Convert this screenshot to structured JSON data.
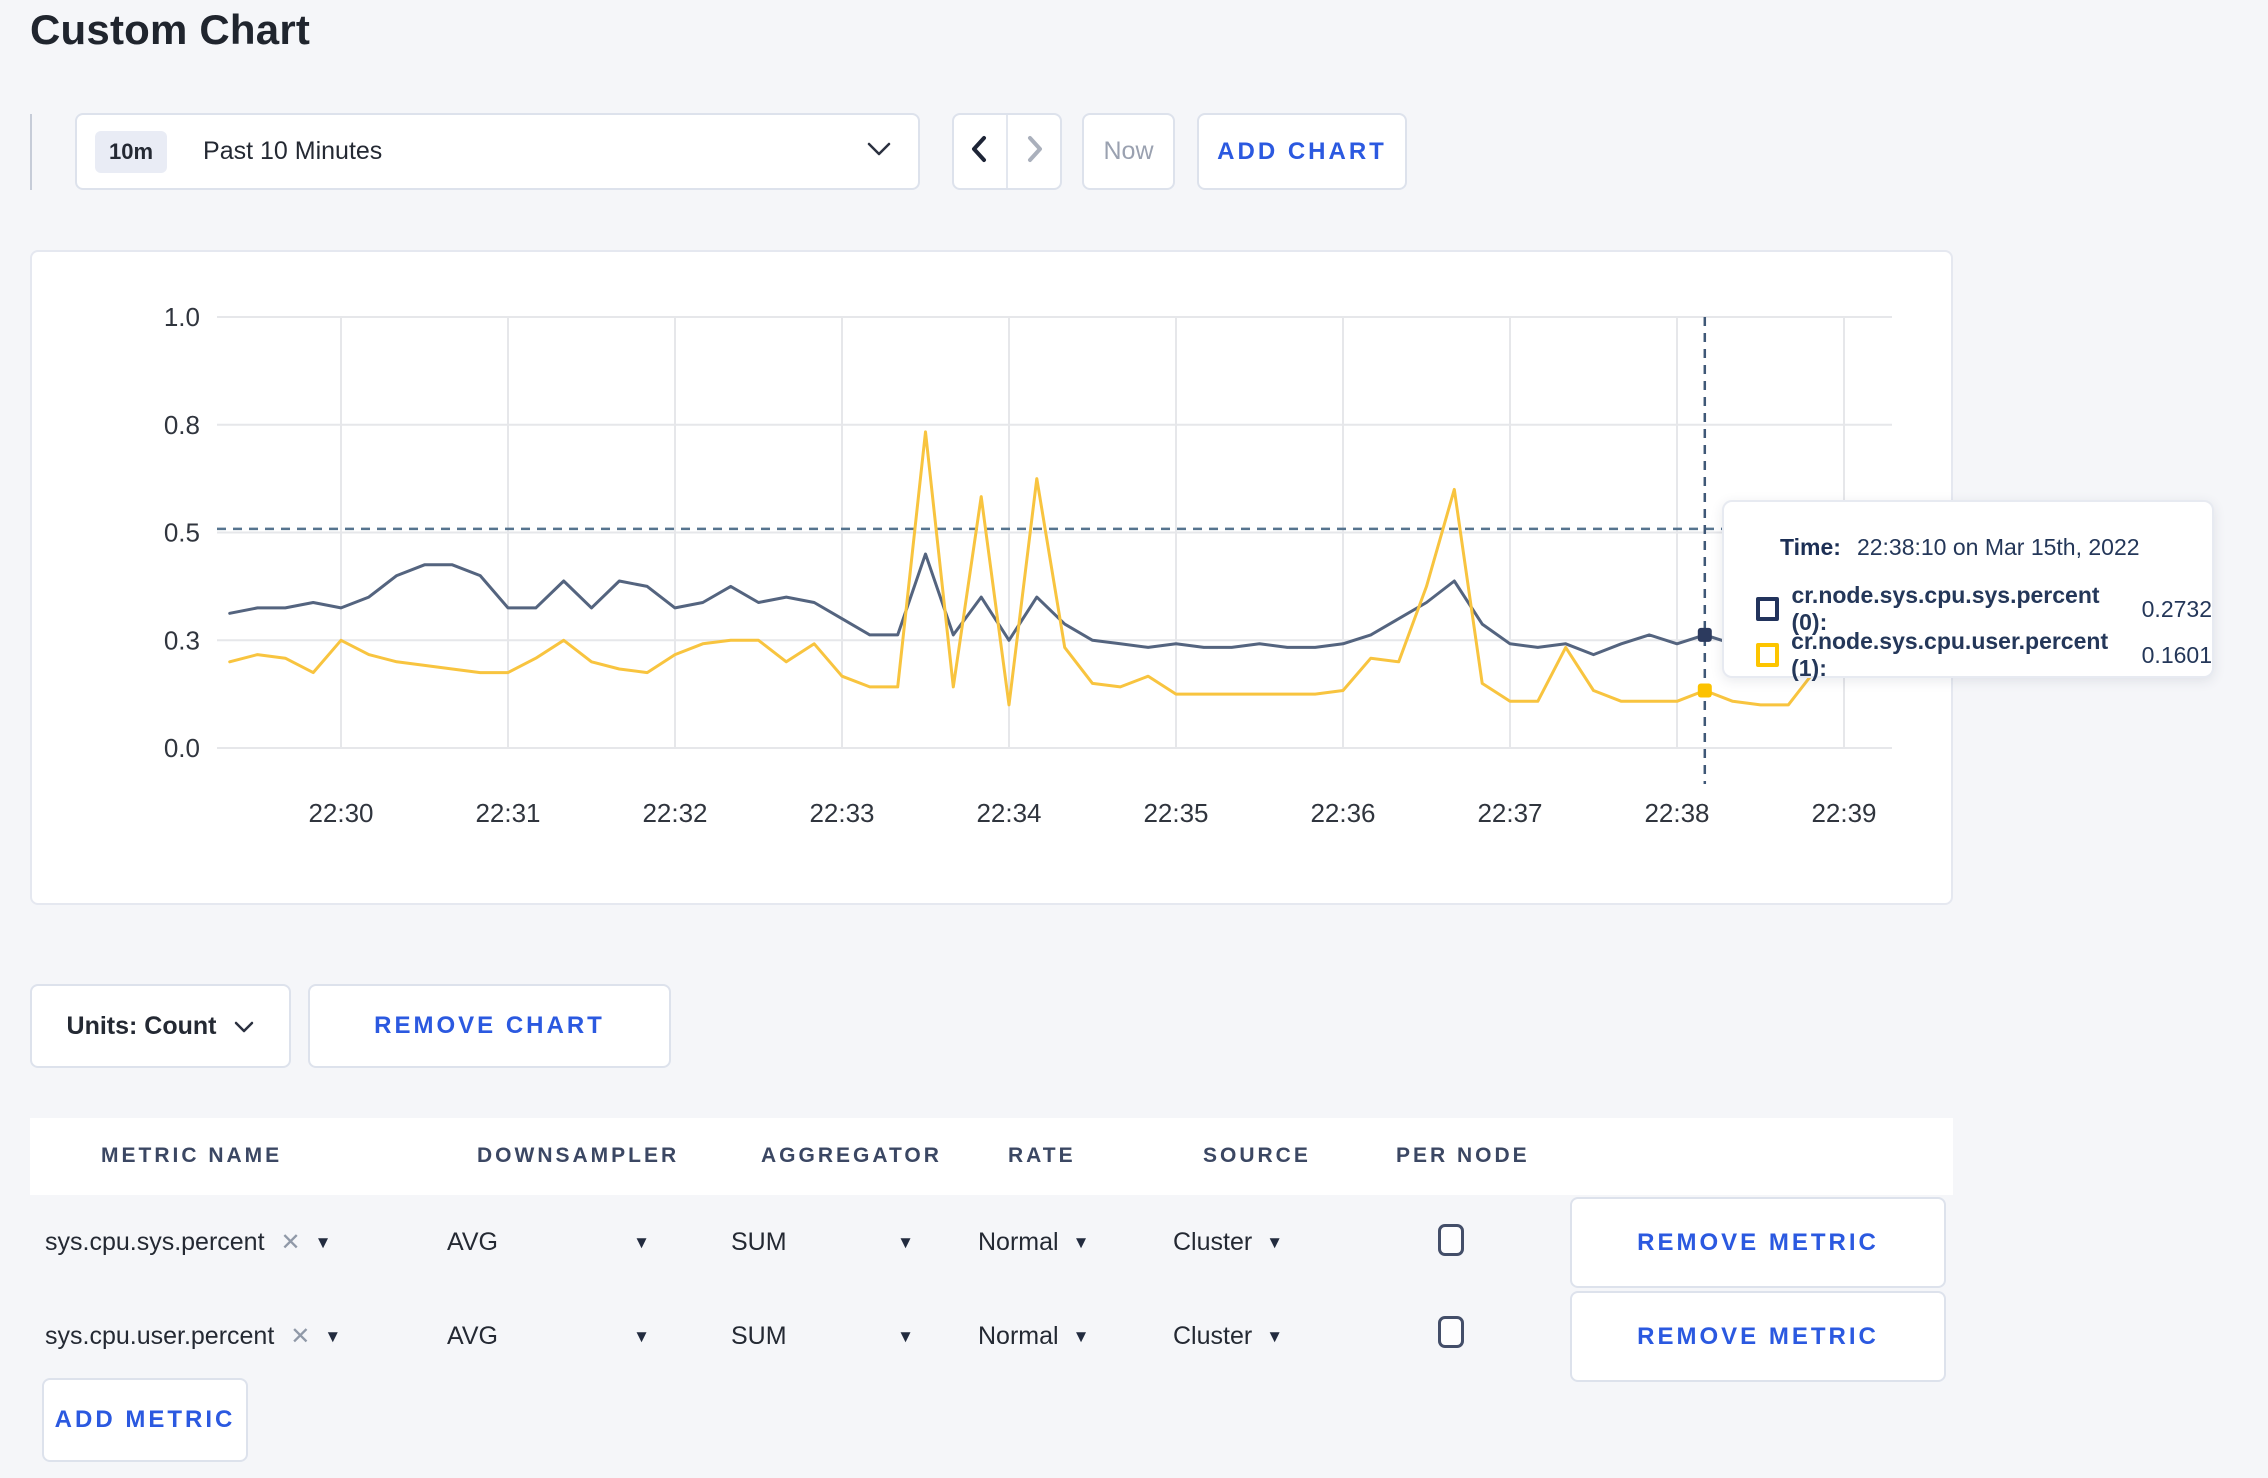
{
  "page": {
    "title": "Custom Chart"
  },
  "controls": {
    "time_range": {
      "badge": "10m",
      "label": "Past 10 Minutes"
    },
    "now_label": "Now",
    "add_chart_label": "ADD CHART"
  },
  "glyphs": {
    "caret_down": "▼",
    "clear": "✕"
  },
  "chart_data": {
    "type": "line",
    "title": "",
    "xlabel": "",
    "ylabel": "",
    "ylim": [
      0,
      1
    ],
    "grid": true,
    "x_ticks": [
      "22:30",
      "22:31",
      "22:32",
      "22:33",
      "22:34",
      "22:35",
      "22:36",
      "22:37",
      "22:38",
      "22:39"
    ],
    "y_ticks": [
      {
        "value": 0,
        "label": "0.0"
      },
      {
        "value": 0.3,
        "label": "0.3"
      },
      {
        "value": 0.5,
        "label": "0.5"
      },
      {
        "value": 0.8,
        "label": "0.8"
      },
      {
        "value": 1.0,
        "label": "1.0"
      }
    ],
    "start_time": "22:29:20",
    "point_interval_seconds": 10,
    "first_tick_point_index": 4,
    "points_per_tick": 6,
    "threshold_line": {
      "value": 0.51,
      "style": "dashed",
      "color": "#56748f"
    },
    "crosshair": {
      "point_index": 53,
      "time": "22:38:10",
      "color": "#3f5877"
    },
    "series": [
      {
        "name": "cr.node.sys.cpu.sys.percent",
        "color": "#54647f",
        "marker_color": "#2c3a5e",
        "values": [
          0.35,
          0.36,
          0.36,
          0.37,
          0.36,
          0.38,
          0.42,
          0.44,
          0.44,
          0.42,
          0.36,
          0.36,
          0.41,
          0.36,
          0.41,
          0.4,
          0.36,
          0.37,
          0.4,
          0.37,
          0.38,
          0.37,
          0.34,
          0.31,
          0.31,
          0.46,
          0.31,
          0.38,
          0.3,
          0.38,
          0.33,
          0.3,
          0.29,
          0.28,
          0.29,
          0.28,
          0.28,
          0.29,
          0.28,
          0.28,
          0.29,
          0.31,
          0.34,
          0.37,
          0.41,
          0.33,
          0.29,
          0.28,
          0.29,
          0.26,
          0.29,
          0.31,
          0.29,
          0.31,
          0.29,
          0.28,
          0.29,
          0.31,
          0.3,
          0.3
        ]
      },
      {
        "name": "cr.node.sys.cpu.user.percent",
        "color": "#f8c43f",
        "marker_color": "#fcc200",
        "values": [
          0.24,
          0.26,
          0.25,
          0.21,
          0.3,
          0.26,
          0.24,
          0.23,
          0.22,
          0.21,
          0.21,
          0.25,
          0.3,
          0.24,
          0.22,
          0.21,
          0.26,
          0.29,
          0.3,
          0.3,
          0.24,
          0.29,
          0.2,
          0.17,
          0.17,
          0.78,
          0.17,
          0.6,
          0.12,
          0.65,
          0.28,
          0.18,
          0.17,
          0.2,
          0.15,
          0.15,
          0.15,
          0.15,
          0.15,
          0.15,
          0.16,
          0.25,
          0.24,
          0.4,
          0.62,
          0.18,
          0.13,
          0.13,
          0.28,
          0.16,
          0.13,
          0.13,
          0.13,
          0.16,
          0.13,
          0.12,
          0.12,
          0.22,
          0.28,
          0.24
        ]
      }
    ],
    "legend_position": "tooltip"
  },
  "tooltip": {
    "time_label": "Time:",
    "time_value": "22:38:10 on Mar 15th, 2022",
    "rows": [
      {
        "label": "cr.node.sys.cpu.sys.percent (0):",
        "value": "0.2732",
        "color": "#22335c"
      },
      {
        "label": "cr.node.sys.cpu.user.percent (1):",
        "value": "0.1601",
        "color": "#fdc500"
      }
    ]
  },
  "chart_footer": {
    "units_label": "Units: Count",
    "remove_chart_label": "REMOVE CHART"
  },
  "table": {
    "headers": [
      "METRIC NAME",
      "DOWNSAMPLER",
      "AGGREGATOR",
      "RATE",
      "SOURCE",
      "PER NODE"
    ],
    "remove_metric_label": "REMOVE METRIC",
    "add_metric_label": "ADD METRIC",
    "rows": [
      {
        "metric": "sys.cpu.sys.percent",
        "downsampler": "AVG",
        "aggregator": "SUM",
        "rate": "Normal",
        "source": "Cluster",
        "per_node": false
      },
      {
        "metric": "sys.cpu.user.percent",
        "downsampler": "AVG",
        "aggregator": "SUM",
        "rate": "Normal",
        "source": "Cluster",
        "per_node": false
      }
    ]
  }
}
